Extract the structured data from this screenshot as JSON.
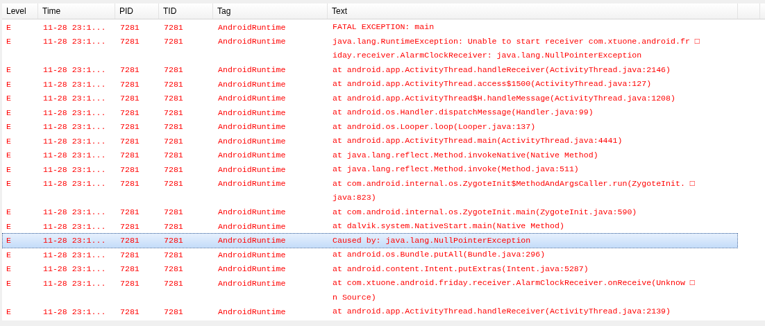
{
  "table": {
    "columns": [
      "Level",
      "Time",
      "PID",
      "TID",
      "Tag",
      "Text"
    ],
    "rows": [
      {
        "level": "E",
        "time": "11-28 23:1...",
        "pid": "7281",
        "tid": "7281",
        "tag": "AndroidRuntime",
        "text": [
          "FATAL EXCEPTION: main"
        ],
        "selected": false
      },
      {
        "level": "E",
        "time": "11-28 23:1...",
        "pid": "7281",
        "tid": "7281",
        "tag": "AndroidRuntime",
        "text": [
          "java.lang.RuntimeException: Unable to start receiver com.xtuone.android.fr □",
          "iday.receiver.AlarmClockReceiver: java.lang.NullPointerException"
        ],
        "selected": false
      },
      {
        "level": "E",
        "time": "11-28 23:1...",
        "pid": "7281",
        "tid": "7281",
        "tag": "AndroidRuntime",
        "text": [
          "at android.app.ActivityThread.handleReceiver(ActivityThread.java:2146)"
        ],
        "selected": false
      },
      {
        "level": "E",
        "time": "11-28 23:1...",
        "pid": "7281",
        "tid": "7281",
        "tag": "AndroidRuntime",
        "text": [
          "at android.app.ActivityThread.access$1500(ActivityThread.java:127)"
        ],
        "selected": false
      },
      {
        "level": "E",
        "time": "11-28 23:1...",
        "pid": "7281",
        "tid": "7281",
        "tag": "AndroidRuntime",
        "text": [
          "at android.app.ActivityThread$H.handleMessage(ActivityThread.java:1208)"
        ],
        "selected": false
      },
      {
        "level": "E",
        "time": "11-28 23:1...",
        "pid": "7281",
        "tid": "7281",
        "tag": "AndroidRuntime",
        "text": [
          "at android.os.Handler.dispatchMessage(Handler.java:99)"
        ],
        "selected": false
      },
      {
        "level": "E",
        "time": "11-28 23:1...",
        "pid": "7281",
        "tid": "7281",
        "tag": "AndroidRuntime",
        "text": [
          "at android.os.Looper.loop(Looper.java:137)"
        ],
        "selected": false
      },
      {
        "level": "E",
        "time": "11-28 23:1...",
        "pid": "7281",
        "tid": "7281",
        "tag": "AndroidRuntime",
        "text": [
          "at android.app.ActivityThread.main(ActivityThread.java:4441)"
        ],
        "selected": false
      },
      {
        "level": "E",
        "time": "11-28 23:1...",
        "pid": "7281",
        "tid": "7281",
        "tag": "AndroidRuntime",
        "text": [
          "at java.lang.reflect.Method.invokeNative(Native Method)"
        ],
        "selected": false
      },
      {
        "level": "E",
        "time": "11-28 23:1...",
        "pid": "7281",
        "tid": "7281",
        "tag": "AndroidRuntime",
        "text": [
          "at java.lang.reflect.Method.invoke(Method.java:511)"
        ],
        "selected": false
      },
      {
        "level": "E",
        "time": "11-28 23:1...",
        "pid": "7281",
        "tid": "7281",
        "tag": "AndroidRuntime",
        "text": [
          "at com.android.internal.os.ZygoteInit$MethodAndArgsCaller.run(ZygoteInit. □",
          "java:823)"
        ],
        "selected": false
      },
      {
        "level": "E",
        "time": "11-28 23:1...",
        "pid": "7281",
        "tid": "7281",
        "tag": "AndroidRuntime",
        "text": [
          "at com.android.internal.os.ZygoteInit.main(ZygoteInit.java:590)"
        ],
        "selected": false
      },
      {
        "level": "E",
        "time": "11-28 23:1...",
        "pid": "7281",
        "tid": "7281",
        "tag": "AndroidRuntime",
        "text": [
          "at dalvik.system.NativeStart.main(Native Method)"
        ],
        "selected": false
      },
      {
        "level": "E",
        "time": "11-28 23:1...",
        "pid": "7281",
        "tid": "7281",
        "tag": "AndroidRuntime",
        "text": [
          "Caused by: java.lang.NullPointerException"
        ],
        "selected": true
      },
      {
        "level": "E",
        "time": "11-28 23:1...",
        "pid": "7281",
        "tid": "7281",
        "tag": "AndroidRuntime",
        "text": [
          "at android.os.Bundle.putAll(Bundle.java:296)"
        ],
        "selected": false
      },
      {
        "level": "E",
        "time": "11-28 23:1...",
        "pid": "7281",
        "tid": "7281",
        "tag": "AndroidRuntime",
        "text": [
          "at android.content.Intent.putExtras(Intent.java:5287)"
        ],
        "selected": false
      },
      {
        "level": "E",
        "time": "11-28 23:1...",
        "pid": "7281",
        "tid": "7281",
        "tag": "AndroidRuntime",
        "text": [
          "at com.xtuone.android.friday.receiver.AlarmClockReceiver.onReceive(Unknow □",
          "n Source)"
        ],
        "selected": false
      },
      {
        "level": "E",
        "time": "11-28 23:1...",
        "pid": "7281",
        "tid": "7281",
        "tag": "AndroidRuntime",
        "text": [
          "at android.app.ActivityThread.handleReceiver(ActivityThread.java:2139)"
        ],
        "selected": false
      }
    ]
  }
}
